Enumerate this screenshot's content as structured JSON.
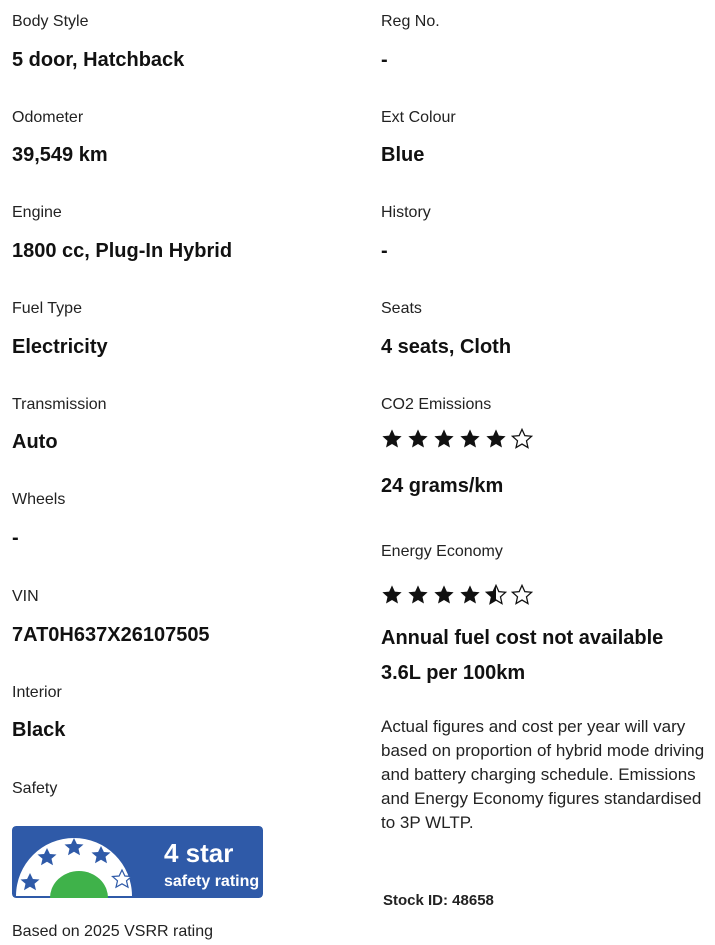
{
  "left": {
    "body_style": {
      "label": "Body Style",
      "value": "5 door, Hatchback"
    },
    "odometer": {
      "label": "Odometer",
      "value": "39,549 km"
    },
    "engine": {
      "label": "Engine",
      "value": "1800 cc, Plug-In Hybrid"
    },
    "fuel_type": {
      "label": "Fuel Type",
      "value": "Electricity"
    },
    "transmission": {
      "label": "Transmission",
      "value": "Auto"
    },
    "wheels": {
      "label": "Wheels",
      "value": "-"
    },
    "vin": {
      "label": "VIN",
      "value": "7AT0H637X26107505"
    },
    "interior": {
      "label": "Interior",
      "value": "Black"
    },
    "safety": {
      "label": "Safety",
      "badge": {
        "stars_text": "4 star",
        "subtitle": "safety rating",
        "stars": 4,
        "max_stars": 5
      },
      "basis": "Based on 2025 VSRR rating"
    }
  },
  "right": {
    "reg_no": {
      "label": "Reg No.",
      "value": "-"
    },
    "ext_colour": {
      "label": "Ext Colour",
      "value": "Blue"
    },
    "history": {
      "label": "History",
      "value": "-"
    },
    "seats": {
      "label": "Seats",
      "value": "4 seats, Cloth"
    },
    "co2": {
      "label": "CO2 Emissions",
      "rating": 5,
      "max": 6,
      "value": "24 grams/km"
    },
    "energy": {
      "label": "Energy Economy",
      "rating": 4.5,
      "max": 6,
      "cost": "Annual fuel cost not available",
      "consumption": "3.6L per 100km"
    },
    "note": "Actual figures and cost per year will vary based on proportion of hybrid mode driving and battery charging schedule. Emissions and Energy Economy figures standardised to 3P WLTP.",
    "stock_id": "Stock ID: 48658"
  },
  "colors": {
    "badge_blue": "#2f5aa8",
    "badge_green": "#3fb24a",
    "badge_white": "#ffffff"
  }
}
